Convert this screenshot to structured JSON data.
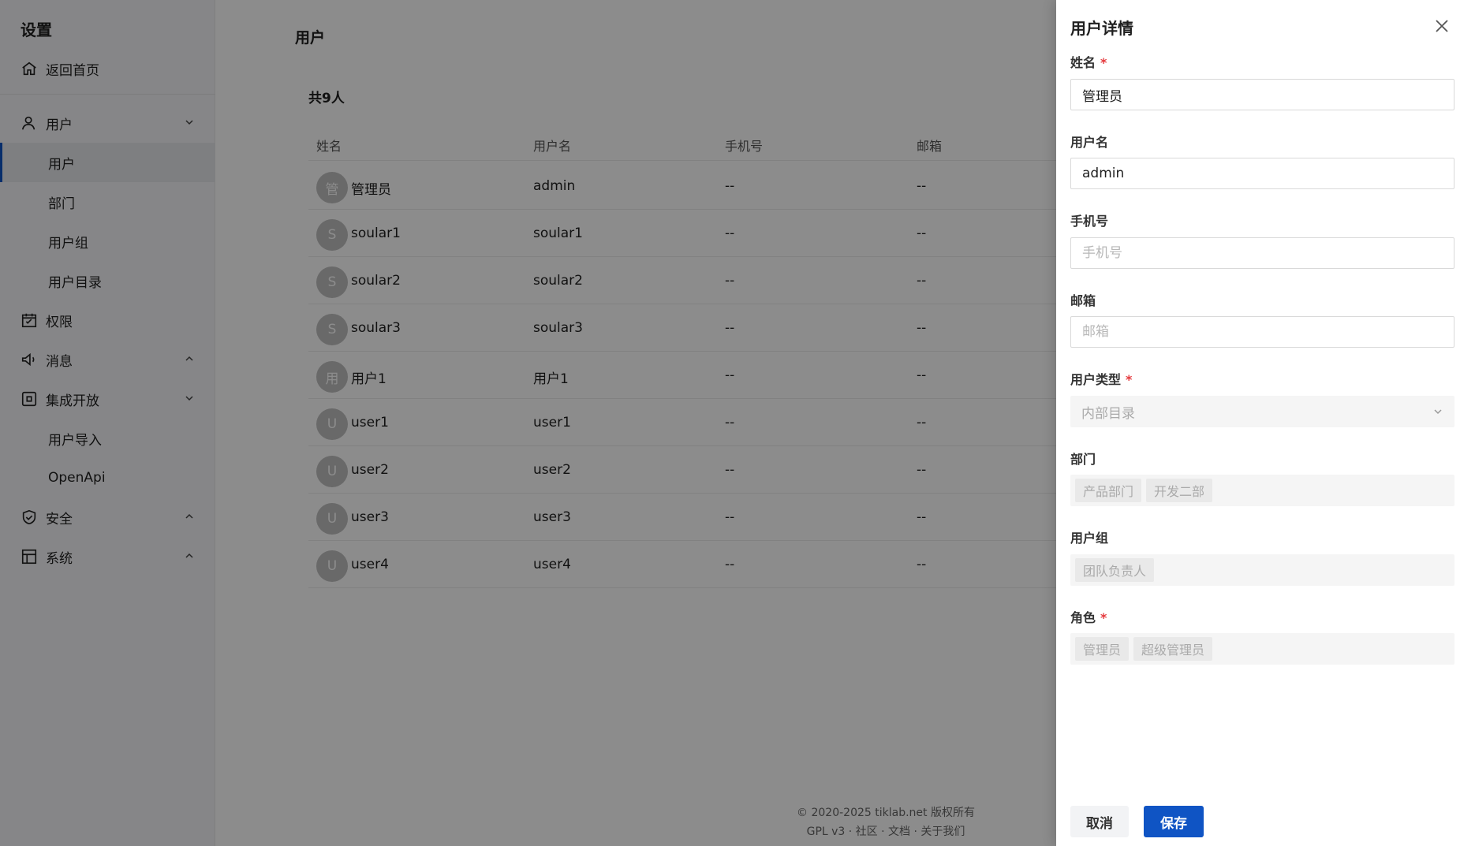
{
  "sidebar": {
    "title": "设置",
    "items": [
      {
        "label": "返回首页",
        "icon": "home-icon"
      },
      {
        "label": "用户",
        "icon": "user-icon",
        "chevron": "down"
      },
      {
        "label": "用户",
        "sub": true,
        "active": true
      },
      {
        "label": "部门",
        "sub": true
      },
      {
        "label": "用户组",
        "sub": true
      },
      {
        "label": "用户目录",
        "sub": true
      },
      {
        "label": "权限",
        "icon": "calendar-icon"
      },
      {
        "label": "消息",
        "icon": "megaphone-icon",
        "chevron": "up"
      },
      {
        "label": "集成开放",
        "icon": "command-icon",
        "chevron": "down"
      },
      {
        "label": "用户导入",
        "sub": true
      },
      {
        "label": "OpenApi",
        "sub": true
      },
      {
        "label": "安全",
        "icon": "shield-icon",
        "chevron": "up"
      },
      {
        "label": "系统",
        "icon": "layout-icon",
        "chevron": "up"
      }
    ]
  },
  "main": {
    "title": "用户",
    "count": "共9人",
    "columns": [
      "姓名",
      "用户名",
      "手机号",
      "邮箱"
    ],
    "rows": [
      {
        "avatar": "管",
        "name": "管理员",
        "username": "admin",
        "phone": "--",
        "email": "--"
      },
      {
        "avatar": "S",
        "name": "soular1",
        "username": "soular1",
        "phone": "--",
        "email": "--"
      },
      {
        "avatar": "S",
        "name": "soular2",
        "username": "soular2",
        "phone": "--",
        "email": "--"
      },
      {
        "avatar": "S",
        "name": "soular3",
        "username": "soular3",
        "phone": "--",
        "email": "--"
      },
      {
        "avatar": "用",
        "name": "用户1",
        "username": "用户1",
        "phone": "--",
        "email": "--"
      },
      {
        "avatar": "U",
        "name": "user1",
        "username": "user1",
        "phone": "--",
        "email": "--"
      },
      {
        "avatar": "U",
        "name": "user2",
        "username": "user2",
        "phone": "--",
        "email": "--"
      },
      {
        "avatar": "U",
        "name": "user3",
        "username": "user3",
        "phone": "--",
        "email": "--"
      },
      {
        "avatar": "U",
        "name": "user4",
        "username": "user4",
        "phone": "--",
        "email": "--"
      }
    ],
    "footer": {
      "copyright": "© 2020-2025 tiklab.net 版权所有",
      "links": "GPL v3 · 社区 · 文档 · 关于我们"
    }
  },
  "drawer": {
    "title": "用户详情",
    "fields": {
      "name": {
        "label": "姓名",
        "value": "管理员"
      },
      "username": {
        "label": "用户名",
        "value": "admin"
      },
      "phone": {
        "label": "手机号",
        "placeholder": "手机号"
      },
      "email": {
        "label": "邮箱",
        "placeholder": "邮箱"
      },
      "user_type": {
        "label": "用户类型",
        "value": "内部目录"
      },
      "department": {
        "label": "部门",
        "tags": [
          "产品部门",
          "开发二部"
        ]
      },
      "group": {
        "label": "用户组",
        "tags": [
          "团队负责人"
        ]
      },
      "role": {
        "label": "角色",
        "tags": [
          "管理员",
          "超级管理员"
        ]
      }
    },
    "cancel_label": "取消",
    "save_label": "保存"
  },
  "colors": {
    "primary": "#0f54c4",
    "required": "#e5393d",
    "mask": "rgba(0,0,0,0.45)"
  }
}
